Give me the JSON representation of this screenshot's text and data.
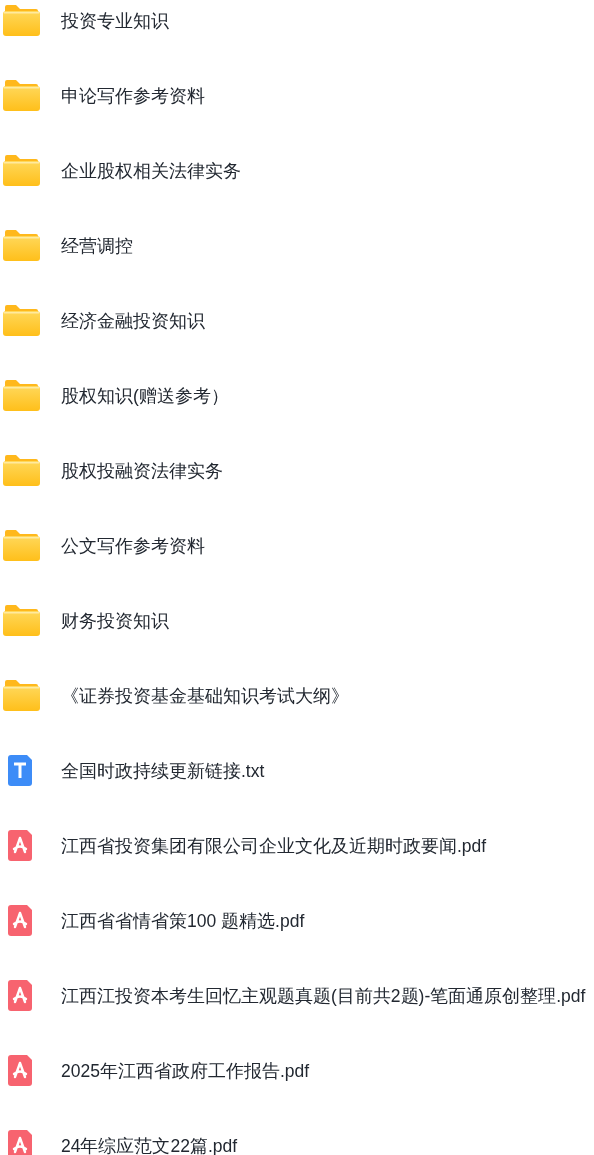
{
  "files": [
    {
      "kind": "folder",
      "name": "投资专业知识"
    },
    {
      "kind": "folder",
      "name": "申论写作参考资料"
    },
    {
      "kind": "folder",
      "name": "企业股权相关法律实务"
    },
    {
      "kind": "folder",
      "name": "经营调控"
    },
    {
      "kind": "folder",
      "name": "经济金融投资知识"
    },
    {
      "kind": "folder",
      "name": "股权知识(赠送参考）"
    },
    {
      "kind": "folder",
      "name": "股权投融资法律实务"
    },
    {
      "kind": "folder",
      "name": "公文写作参考资料"
    },
    {
      "kind": "folder",
      "name": "财务投资知识"
    },
    {
      "kind": "folder",
      "name": "《证券投资基金基础知识考试大纲》"
    },
    {
      "kind": "txt",
      "name": "全国时政持续更新链接.txt"
    },
    {
      "kind": "pdf",
      "name": "江西省投资集团有限公司企业文化及近期时政要闻.pdf"
    },
    {
      "kind": "pdf",
      "name": "江西省省情省策100 题精选.pdf"
    },
    {
      "kind": "pdf",
      "name": "江西江投资本考生回忆主观题真题(目前共2题)-笔面通原创整理.pdf"
    },
    {
      "kind": "pdf",
      "name": "2025年江西省政府工作报告.pdf"
    },
    {
      "kind": "pdf",
      "name": "24年综应范文22篇.pdf"
    }
  ]
}
